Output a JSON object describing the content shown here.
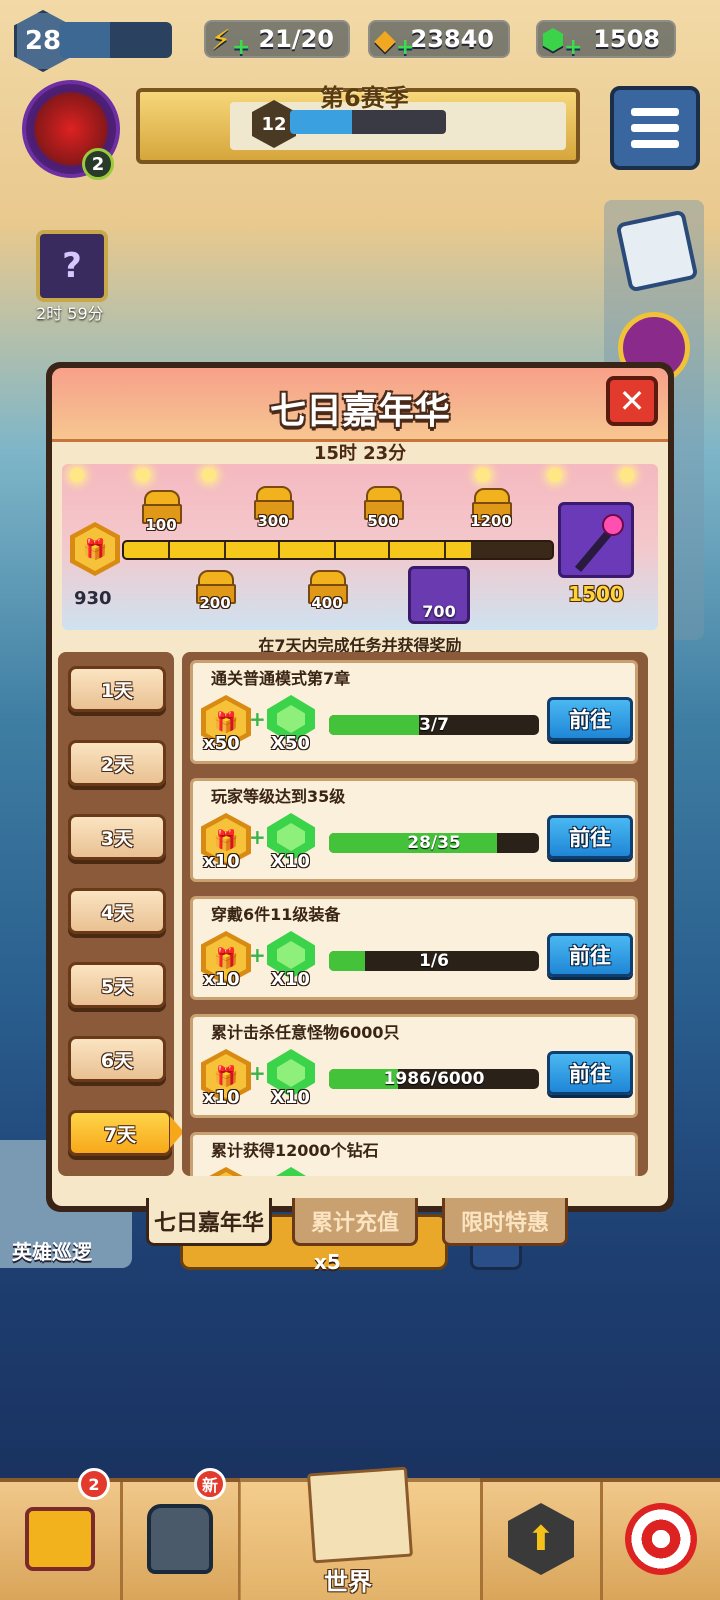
{
  "hud": {
    "player_level": "28",
    "energy": "21/20",
    "coins": "23840",
    "gems": "1508",
    "avatar_badge": "2",
    "season_title": "第6赛季",
    "season_level": "12",
    "season_progress": 0.4,
    "offer_timer": "2时 59分",
    "xp_progress": 0.45
  },
  "modal": {
    "title": "七日嘉年华",
    "close_label": "✕",
    "timer": "15时 23分",
    "total_points": "930",
    "progress_fraction": 0.81,
    "milestones_top": [
      "100",
      "300",
      "500",
      "1200"
    ],
    "milestones_bottom": [
      "200",
      "400"
    ],
    "milestone_armor": "700",
    "milestone_final": "1500",
    "subtitle": "在7天内完成任务并获得奖励",
    "days": [
      "1天",
      "2天",
      "3天",
      "4天",
      "5天",
      "6天",
      "7天"
    ],
    "active_day_index": 6,
    "tasks": [
      {
        "title": "通关普通模式第7章",
        "gift_qty": "x50",
        "gem_qty": "X50",
        "progress_text": "3/7",
        "progress": 0.43,
        "button": "前往"
      },
      {
        "title": "玩家等级达到35级",
        "gift_qty": "x10",
        "gem_qty": "X10",
        "progress_text": "28/35",
        "progress": 0.8,
        "button": "前往"
      },
      {
        "title": "穿戴6件11级装备",
        "gift_qty": "x10",
        "gem_qty": "X10",
        "progress_text": "1/6",
        "progress": 0.17,
        "button": "前往"
      },
      {
        "title": "累计击杀任意怪物6000只",
        "gift_qty": "x10",
        "gem_qty": "X10",
        "progress_text": "1986/6000",
        "progress": 0.33,
        "button": "前往"
      },
      {
        "title": "累计获得12000个钻石",
        "gift_qty": "",
        "gem_qty": "",
        "progress_text": "",
        "progress": 0,
        "button": ""
      }
    ],
    "tabs": [
      "七日嘉年华",
      "累计充值",
      "限时特惠"
    ]
  },
  "background": {
    "hero_patrol_label": "英雄巡逻",
    "energy_button_label": "x5"
  },
  "bottom_nav": {
    "chest_badge": "2",
    "armor_badge": "新",
    "world_label": "世界"
  }
}
